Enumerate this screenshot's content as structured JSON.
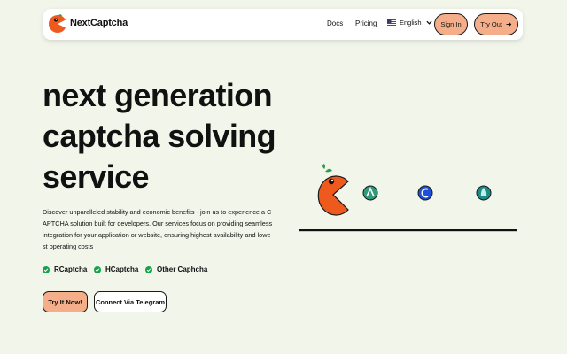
{
  "nav": {
    "brand": "NextCaptcha",
    "links": [
      "Docs",
      "Pricing"
    ],
    "language": "English",
    "sign_in": "Sign In",
    "try_out": "Try Out"
  },
  "hero": {
    "title": "next generation captcha solving service",
    "description": "Discover unparalleled stability and economic benefits - join us to experience a CAPTCHA solution built for developers. Our services focus on providing seamless integration for your application or website, ensuring highest availability and lowest operating costs",
    "features": [
      "RCaptcha",
      "HCaptcha",
      "Other Caphcha"
    ],
    "cta_primary": "Try It Now!",
    "cta_secondary": "Connect Via Telegram"
  },
  "colors": {
    "background": "#f1f5ea",
    "accent": "#f5ae8a",
    "pacman": "#ee5a1e",
    "check": "#15a34a"
  },
  "icons": [
    "logo-icon",
    "us-flag-icon",
    "chevron-down-icon",
    "arrow-right-icon",
    "check-icon",
    "pacman-icon",
    "recaptcha-icon",
    "captcha-c-icon",
    "hcaptcha-icon"
  ]
}
